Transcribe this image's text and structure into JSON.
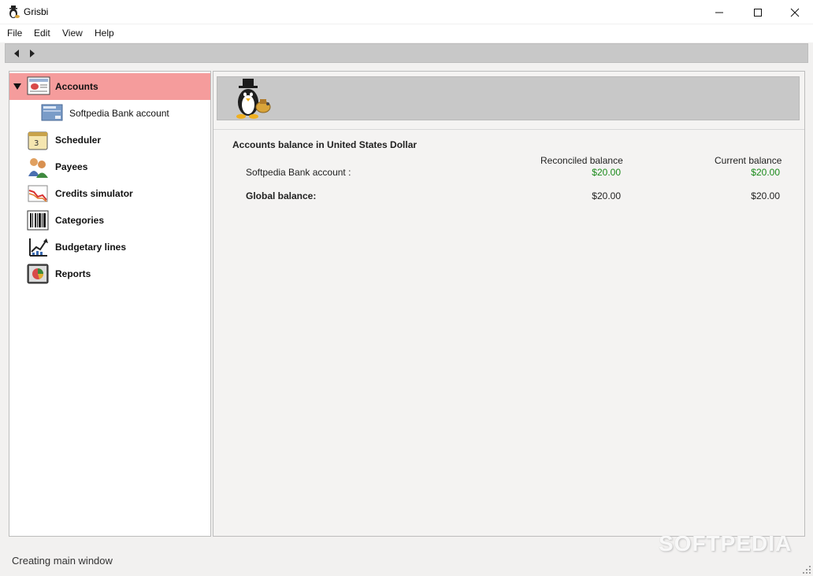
{
  "window": {
    "title": "Grisbi",
    "icon": "grisbi-penguin-icon",
    "controls": [
      "minimize-icon",
      "maximize-icon",
      "close-icon"
    ]
  },
  "menu": {
    "items": [
      "File",
      "Edit",
      "View",
      "Help"
    ]
  },
  "toolbar": {
    "icons": [
      "back-arrow-icon",
      "forward-arrow-icon"
    ]
  },
  "sidebar": {
    "items": [
      {
        "label": "Accounts",
        "icon": "accounts-icon",
        "selected": true,
        "expanded": true
      },
      {
        "label": "Softpedia Bank account",
        "icon": "bank-card-icon",
        "child": true
      },
      {
        "label": "Scheduler",
        "icon": "calendar-icon"
      },
      {
        "label": "Payees",
        "icon": "people-icon"
      },
      {
        "label": "Credits simulator",
        "icon": "credit-chart-icon"
      },
      {
        "label": "Categories",
        "icon": "barcode-icon"
      },
      {
        "label": "Budgetary lines",
        "icon": "budget-chart-icon"
      },
      {
        "label": "Reports",
        "icon": "reports-icon"
      }
    ]
  },
  "main": {
    "banner_icon": "grisbi-mascot-icon",
    "heading": "Accounts balance in United States Dollar",
    "columns": {
      "reconciled": "Reconciled balance",
      "current": "Current balance"
    },
    "rows": [
      {
        "name": "Softpedia Bank account :",
        "reconciled": "$20.00",
        "current": "$20.00"
      }
    ],
    "global": {
      "name": "Global balance:",
      "reconciled": "$20.00",
      "current": "$20.00"
    }
  },
  "status": {
    "text": "Creating main window"
  },
  "watermark": "SOFTPEDIA",
  "colors": {
    "selected_row": "#f59c9c",
    "positive_amount": "#1a8a1a",
    "toolbar": "#c8c8c8"
  }
}
